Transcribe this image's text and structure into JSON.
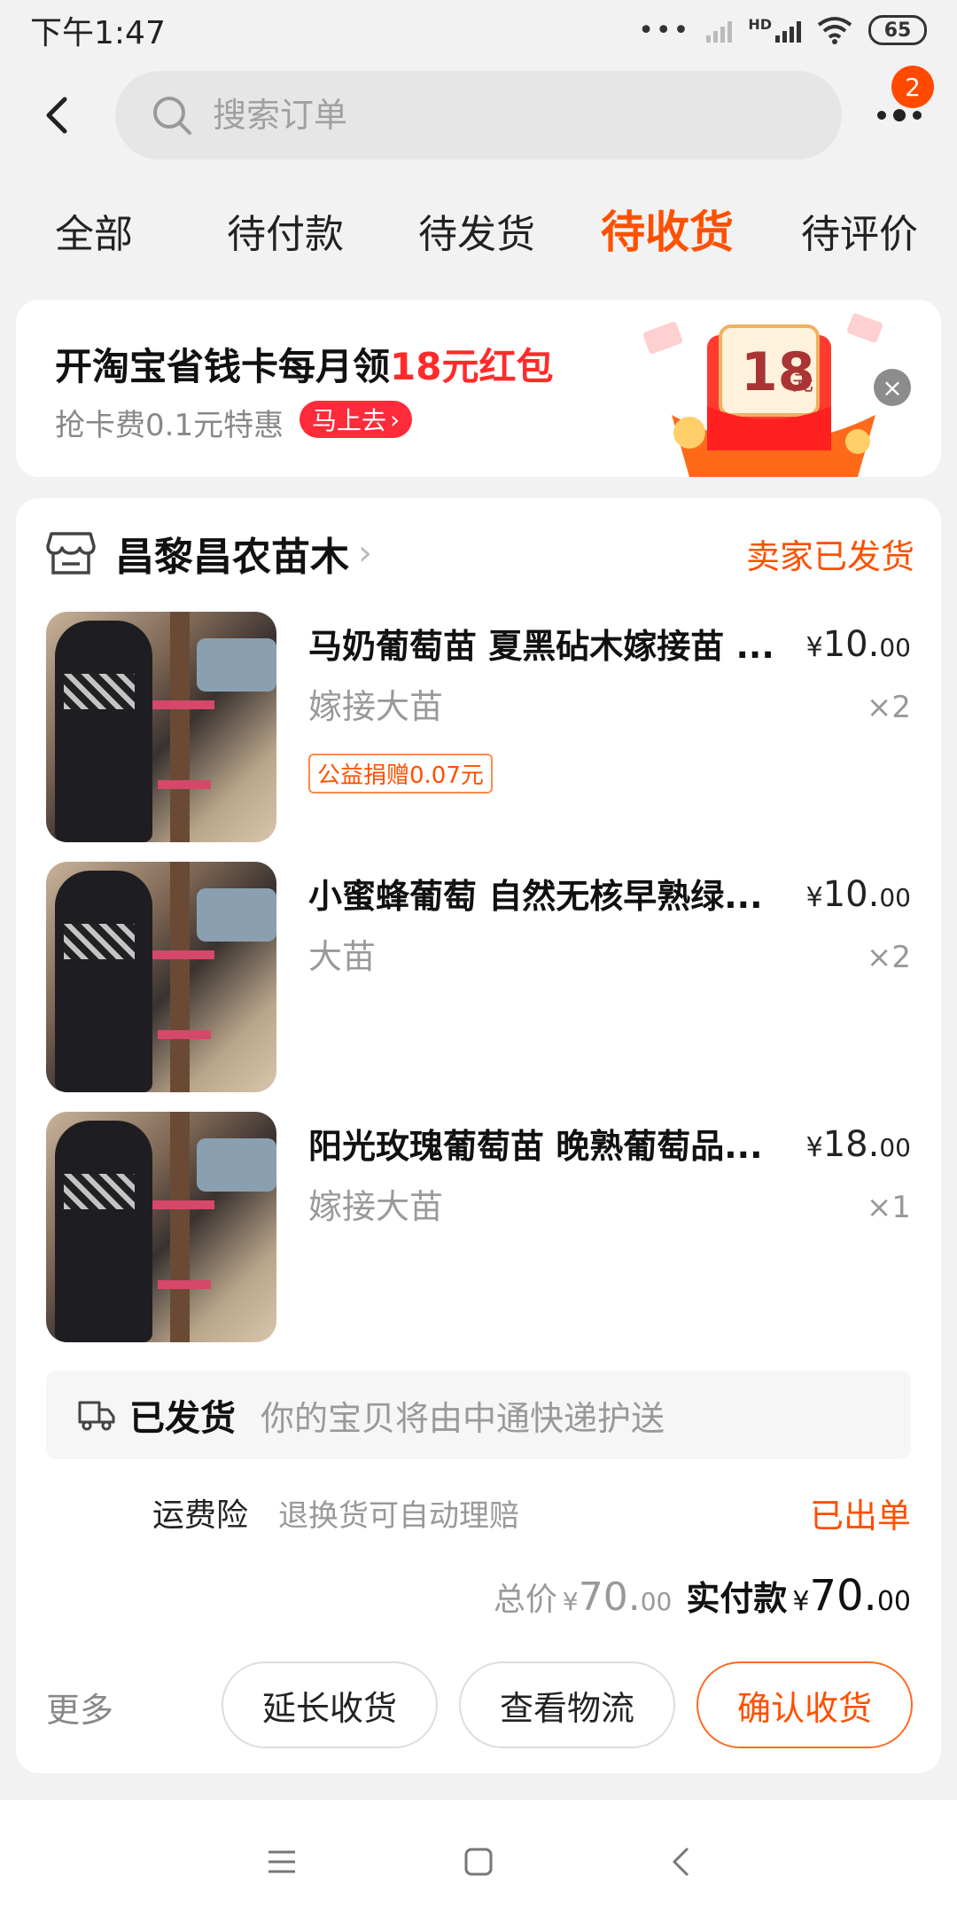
{
  "status_bar": {
    "time": "下午1:47",
    "battery": "65",
    "network": "HD"
  },
  "header": {
    "search_placeholder": "搜索订单",
    "badge_count": "2"
  },
  "tabs": [
    {
      "label": "全部"
    },
    {
      "label": "待付款"
    },
    {
      "label": "待发货"
    },
    {
      "label": "待收货",
      "active": true
    },
    {
      "label": "待评价"
    }
  ],
  "promo": {
    "title_prefix": "开淘宝省钱卡每月领",
    "title_highlight": "18元红包",
    "subtitle": "抢卡费0.1元特惠",
    "button": "马上去",
    "art_amount": "18",
    "art_unit": "元"
  },
  "order": {
    "shop_name": "昌黎昌农苗木",
    "status": "卖家已发货",
    "items": [
      {
        "title": "马奶葡萄苗 夏黑砧木嫁接苗 ...",
        "spec": "嫁接大苗",
        "price_yen": "¥",
        "price_int": "10.",
        "price_cents": "00",
        "qty": "×2",
        "charity": "公益捐赠0.07元"
      },
      {
        "title": "小蜜蜂葡萄 自然无核早熟绿...",
        "spec": "大苗",
        "price_yen": "¥",
        "price_int": "10.",
        "price_cents": "00",
        "qty": "×2"
      },
      {
        "title": "阳光玫瑰葡萄苗 晚熟葡萄品...",
        "spec": "嫁接大苗",
        "price_yen": "¥",
        "price_int": "18.",
        "price_cents": "00",
        "qty": "×1"
      }
    ],
    "shipping": {
      "label": "已发货",
      "desc": "你的宝贝将由中通快递护送"
    },
    "insurance": {
      "label": "运费险",
      "desc": "退换货可自动理赔",
      "status": "已出单"
    },
    "totals": {
      "total_label": "总价",
      "total_yen": "¥",
      "total_int": "70.",
      "total_cents": "00",
      "paid_label": "实付款",
      "paid_yen": "¥",
      "paid_int": "70.",
      "paid_cents": "00"
    },
    "actions": {
      "more": "更多",
      "extend": "延长收货",
      "logistics": "查看物流",
      "confirm": "确认收货"
    }
  },
  "colors": {
    "accent": "#ff5000",
    "promo_red": "#ff2b2b",
    "background": "#f2f2f2"
  }
}
